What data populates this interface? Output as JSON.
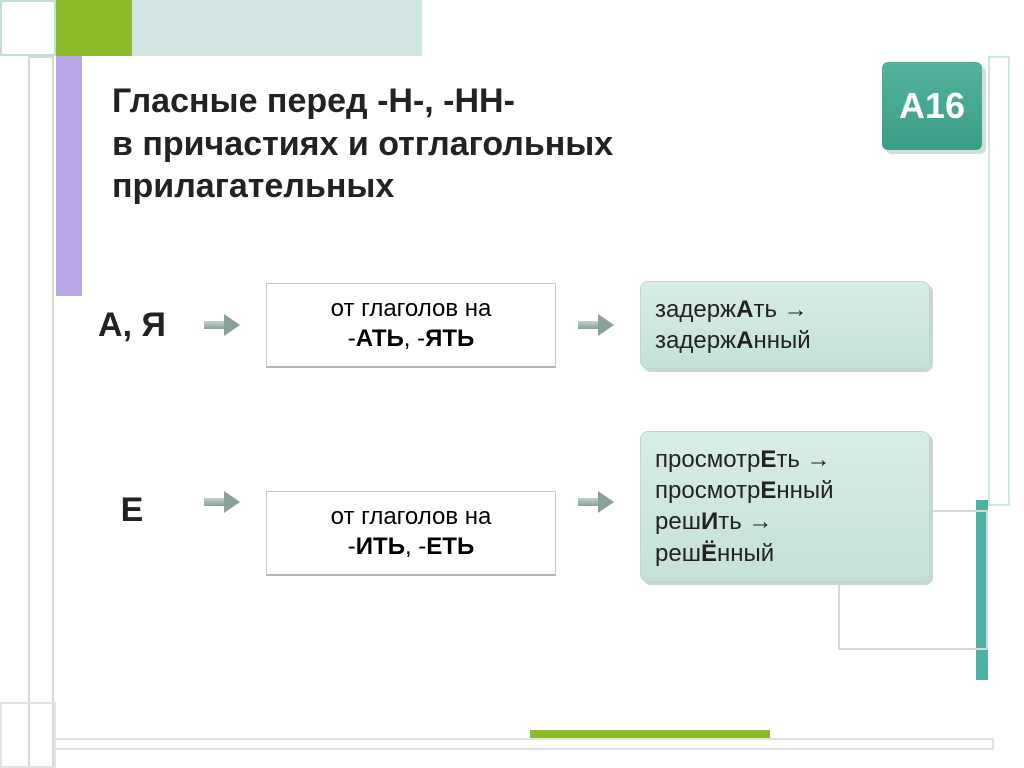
{
  "badge": "А16",
  "title": "Гласные перед  -Н-, -НН-\nв причастиях и отглагольных\nприлагательных",
  "row1": {
    "letters": "А, Я",
    "mid_line1": "от глаголов на",
    "mid_line2_pre": "-",
    "mid_line2_b1": "АТЬ",
    "mid_line2_mid": ", -",
    "mid_line2_b2": "ЯТЬ",
    "ex_l1a": "задерж",
    "ex_l1b": "А",
    "ex_l1c": "ть →",
    "ex_l2a": "задерж",
    "ex_l2b": "А",
    "ex_l2c": "нный"
  },
  "row2": {
    "letters": "Е",
    "mid_line1": "от глаголов на",
    "mid_line2_pre": "-",
    "mid_line2_b1": "ИТЬ",
    "mid_line2_mid": ", -",
    "mid_line2_b2": "ЕТЬ",
    "ex_l1a": "просмотр",
    "ex_l1b": "Е",
    "ex_l1c": "ть →",
    "ex_l2a": "просмотр",
    "ex_l2b": "Е",
    "ex_l2c": "нный",
    "ex_l3a": "реш",
    "ex_l3b": "И",
    "ex_l3c": "ть →",
    "ex_l4a": "реш",
    "ex_l4b": "Ё",
    "ex_l4c": "нный"
  }
}
